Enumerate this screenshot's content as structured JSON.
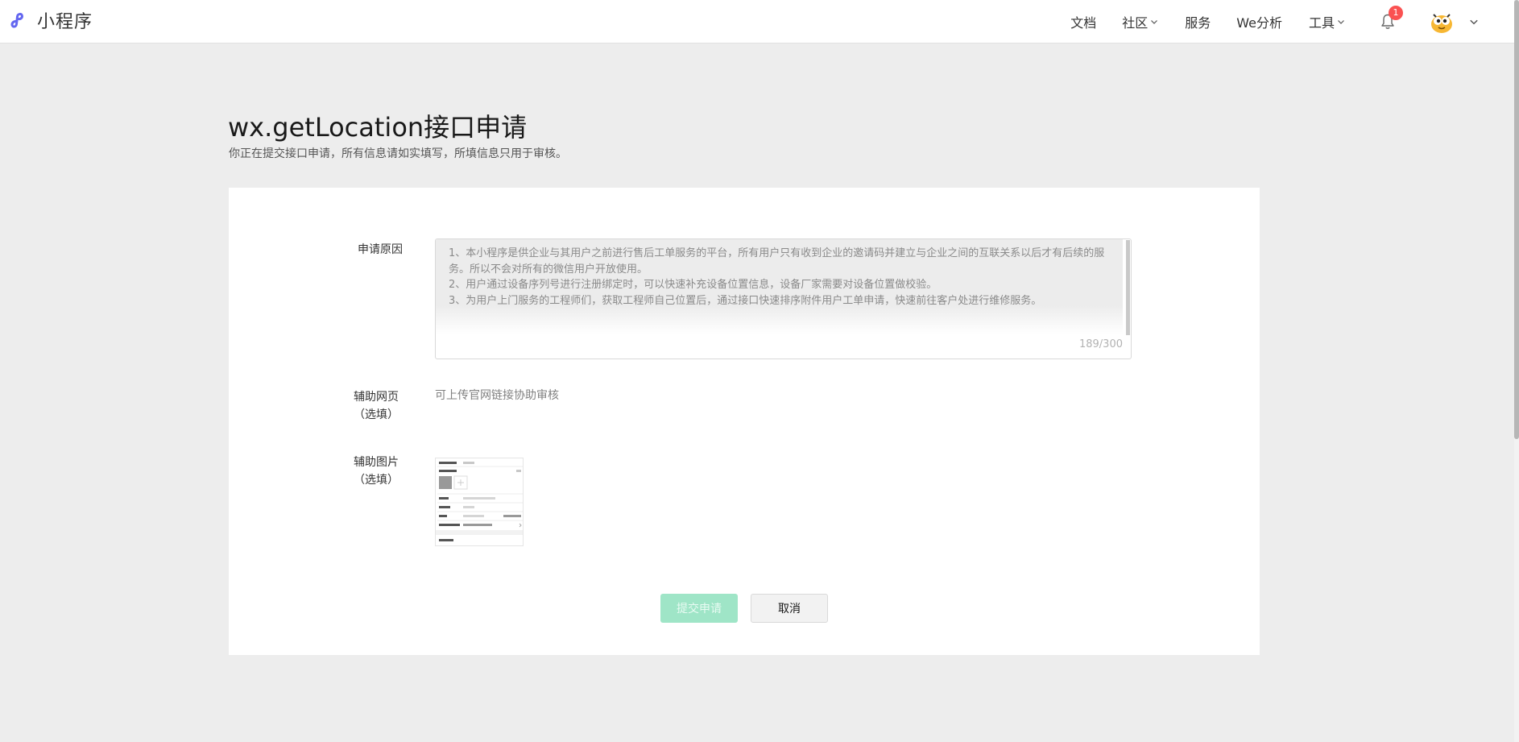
{
  "header": {
    "brand_name": "小程序",
    "brand_color": "#6467f0",
    "nav": {
      "docs": "文档",
      "community": "社区",
      "services": "服务",
      "we_analytics": "We分析",
      "tools": "工具"
    },
    "notification_count": "1",
    "icons": [
      "miniprogram-logo-icon",
      "chevron-down-icon",
      "bell-icon",
      "avatar",
      "chevron-down-icon"
    ]
  },
  "page": {
    "title": "wx.getLocation接口申请",
    "description": "你正在提交接口申请，所有信息请如实填写，所填信息只用于审核。"
  },
  "form": {
    "reason": {
      "label": "申请原因",
      "value": "1、本小程序是供企业与其用户之前进行售后工单服务的平台，所有用户只有收到企业的邀请码并建立与企业之间的互联关系以后才有后续的服务。所以不会对所有的微信用户开放使用。\n2、用户通过设备序列号进行注册绑定时，可以快速补充设备位置信息，设备厂家需要对设备位置做校验。\n3、为用户上门服务的工程师们，获取工程师自己位置后，通过接口快速排序附件用户工单申请，快速前往客户处进行维修服务。",
      "counter": "189/300"
    },
    "webpage": {
      "label_line1": "辅助网页",
      "label_line2": "（选填）",
      "hint": "可上传官网链接协助审核"
    },
    "image": {
      "label_line1": "辅助图片",
      "label_line2": "（选填）"
    },
    "submit_label": "提交申请",
    "cancel_label": "取消",
    "submit_color": "#9fe5c7"
  }
}
